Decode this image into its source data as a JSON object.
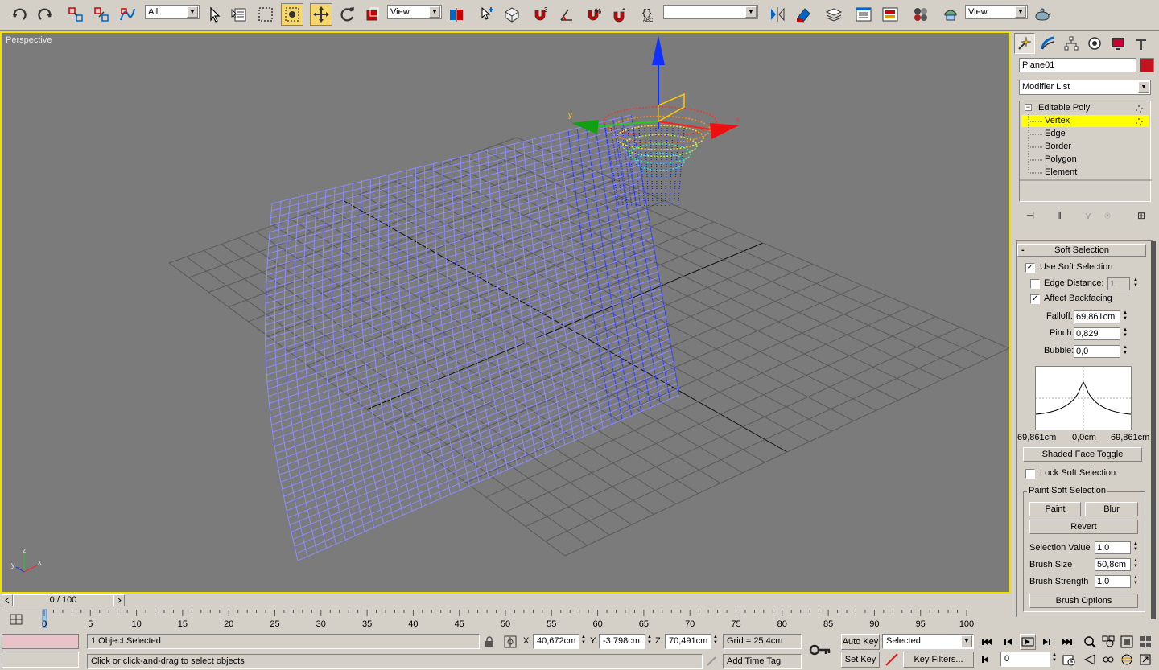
{
  "toolbar": {
    "selection_filter": "All",
    "ref_coord_1": "View",
    "named_selection": "",
    "ref_coord_2": "View",
    "snap_label": "3",
    "percent_label": "%"
  },
  "viewport": {
    "label": "Perspective",
    "axis_x": "x",
    "axis_y": "y",
    "axis_z": "z"
  },
  "panel": {
    "object_name": "Plane01",
    "object_color": "#c3141e",
    "modifier_list": "Modifier List",
    "stack": [
      {
        "label": "Editable Poly"
      },
      {
        "label": "Vertex"
      },
      {
        "label": "Edge"
      },
      {
        "label": "Border"
      },
      {
        "label": "Polygon"
      },
      {
        "label": "Element"
      }
    ],
    "soft_selection": {
      "title": "Soft Selection",
      "use_soft_selection": "Use Soft Selection",
      "use_soft_selection_checked": true,
      "edge_distance": "Edge Distance:",
      "edge_distance_checked": false,
      "edge_distance_value": "1",
      "affect_backfacing": "Affect Backfacing",
      "affect_backfacing_checked": true,
      "falloff_label": "Falloff:",
      "falloff_value": "69,861cm",
      "pinch_label": "Pinch:",
      "pinch_value": "0,829",
      "bubble_label": "Bubble:",
      "bubble_value": "0,0",
      "curve_left": "69,861cm",
      "curve_center": "0,0cm",
      "curve_right": "69,861cm",
      "shaded_face_toggle": "Shaded Face Toggle",
      "lock_soft_selection": "Lock Soft Selection",
      "lock_soft_selection_checked": false,
      "paint_group_title": "Paint Soft Selection",
      "paint": "Paint",
      "blur": "Blur",
      "revert": "Revert",
      "selection_value_label": "Selection Value",
      "selection_value": "1,0",
      "brush_size_label": "Brush Size",
      "brush_size": "50,8cm",
      "brush_strength_label": "Brush Strength",
      "brush_strength": "1,0",
      "brush_options": "Brush Options"
    }
  },
  "timeslider": {
    "frame_display": "0 / 100",
    "ticks": [
      "0",
      "5",
      "10",
      "15",
      "20",
      "25",
      "30",
      "35",
      "40",
      "45",
      "50",
      "55",
      "60",
      "65",
      "70",
      "75",
      "80",
      "85",
      "90",
      "95",
      "100"
    ]
  },
  "status": {
    "selection_count": "1 Object Selected",
    "prompt": "Click or click-and-drag to select objects",
    "x_label": "X:",
    "x_value": "40,672cm",
    "y_label": "Y:",
    "y_value": "-3,798cm",
    "z_label": "Z:",
    "z_value": "70,491cm",
    "grid": "Grid = 25,4cm",
    "add_time_tag": "Add Time Tag",
    "auto_key": "Auto Key",
    "set_key": "Set Key",
    "key_mode": "Selected",
    "key_filters": "Key Filters...",
    "current_frame": "0"
  }
}
